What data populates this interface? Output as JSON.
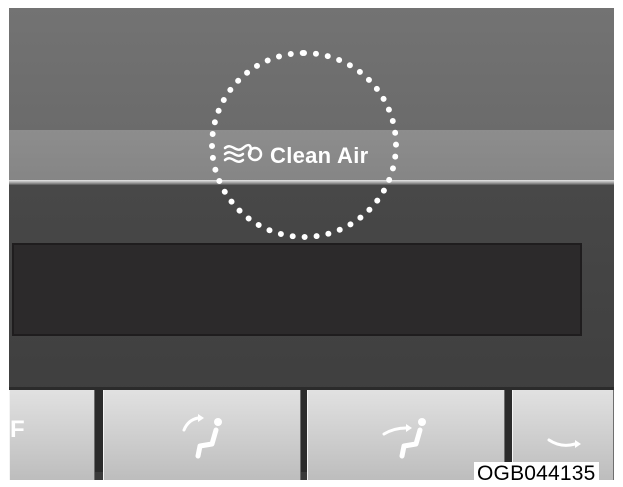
{
  "control_panel": {
    "clean_air_label": "Clean Air",
    "off_button_label": "F",
    "display_colors": {
      "panel": "#6e6e6e",
      "label_band": "#898989",
      "display_window": "#2c2a2b",
      "buttons": "#d0d0d0",
      "highlight_circle": "#ffffff"
    },
    "icons": [
      "clean-air-wave-icon",
      "vent-face-icon",
      "vent-bilevel-icon",
      "vent-floor-icon"
    ]
  },
  "image_code": "OGB044135"
}
